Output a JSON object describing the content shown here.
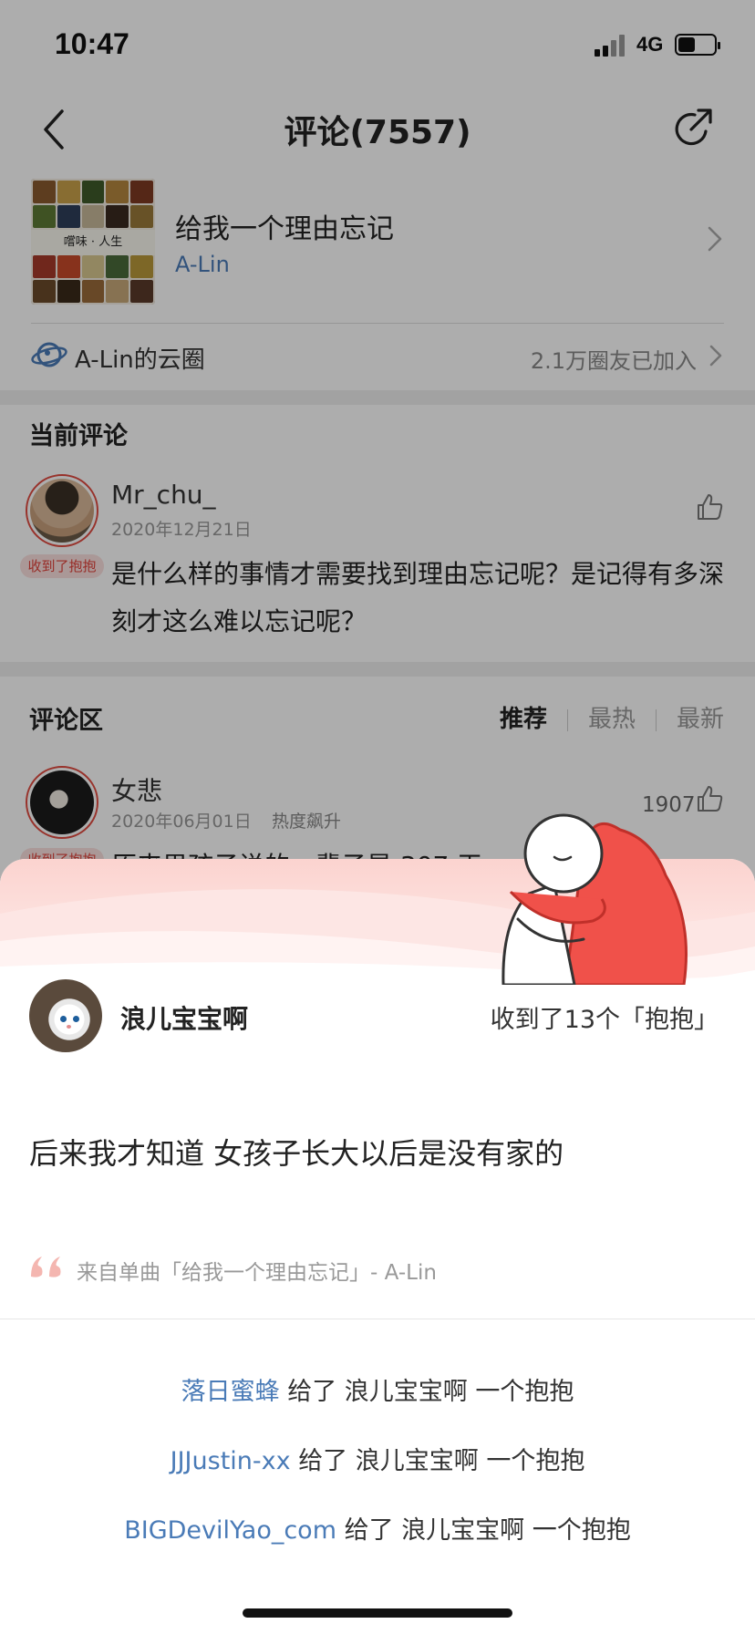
{
  "status_bar": {
    "time": "10:47",
    "network": "4G"
  },
  "nav": {
    "title": "评论(7557)"
  },
  "song": {
    "title": "给我一个理由忘记",
    "artist": "A-Lin",
    "cover_text": "嚐味 · 人生"
  },
  "circle": {
    "name": "A-Lin的云圈",
    "count": "2.1万圈友已加入"
  },
  "current_comment": {
    "section_title": "当前评论",
    "user": "Mr_chu_",
    "date": "2020年12月21日",
    "badge": "收到了抱抱",
    "text": "是什么样的事情才需要找到理由忘记呢？是记得有多深刻才这么难以忘记呢？"
  },
  "comment_area": {
    "title": "评论区",
    "sort_tabs": [
      "推荐",
      "最热",
      "最新"
    ],
    "active_sort": "推荐",
    "comment": {
      "user": "女悲",
      "date": "2020年06月01日",
      "hot": "热度飙升",
      "likes": "1907",
      "badge": "收到了抱抱",
      "text_partial": "原来男孩子说的一辈子是 307 天"
    }
  },
  "sheet": {
    "user": "浪儿宝宝啊",
    "received": "收到了13个「抱抱」",
    "quote": "后来我才知道 女孩子长大以后是没有家的",
    "source": "来自单曲「给我一个理由忘记」- A-Lin",
    "hugs": [
      {
        "giver": "落日蜜蜂",
        "action": "给了",
        "receiver": "浪儿宝宝啊",
        "suffix": "一个抱抱"
      },
      {
        "giver": "JJJustin-xx",
        "action": "给了",
        "receiver": "浪儿宝宝啊",
        "suffix": "一个抱抱"
      },
      {
        "giver": "BIGDevilYao_com",
        "action": "给了",
        "receiver": "浪儿宝宝啊",
        "suffix": "一个抱抱"
      }
    ]
  },
  "colors": {
    "accent_red": "#e0413a",
    "link_blue": "#4a7bb7",
    "sheet_wave": "#fde6e4"
  }
}
